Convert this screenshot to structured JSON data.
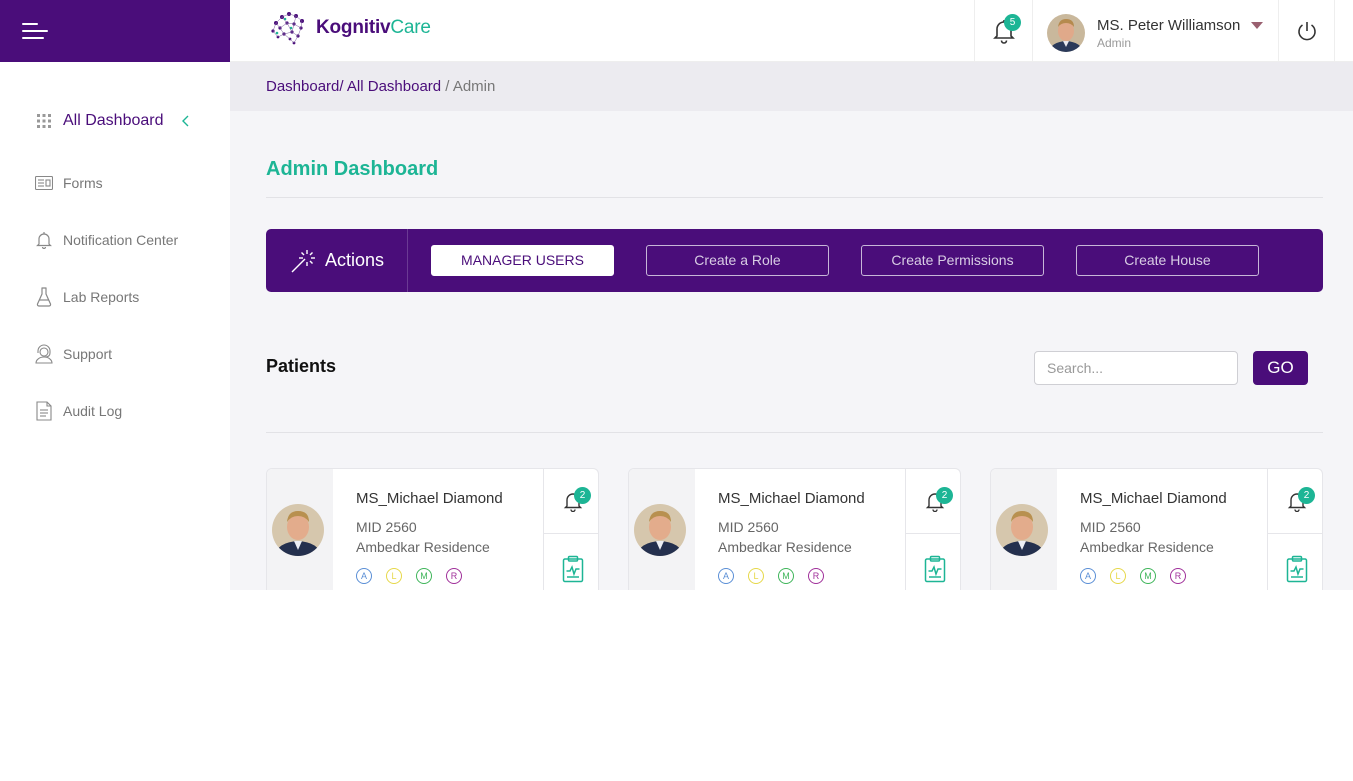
{
  "app": {
    "logo_main": "Kognitiv",
    "logo_accent": "Care"
  },
  "sidebar": {
    "items": [
      {
        "label": "All Dashboard",
        "icon": "grid-icon"
      },
      {
        "label": "Forms",
        "icon": "form-icon"
      },
      {
        "label": "Notification Center",
        "icon": "bell-icon"
      },
      {
        "label": "Lab Reports",
        "icon": "flask-icon"
      },
      {
        "label": "Support",
        "icon": "support-agent-icon"
      },
      {
        "label": "Audit Log",
        "icon": "document-icon"
      }
    ]
  },
  "header": {
    "notification_count": "5",
    "user_name": "MS. Peter Williamson",
    "user_role": "Admin"
  },
  "breadcrumb": {
    "part1": "Dashboard/",
    "part2": "All Dashboard",
    "separator": "/",
    "current": "Admin"
  },
  "page": {
    "title": "Admin Dashboard"
  },
  "actions": {
    "label": "Actions",
    "buttons": [
      "MANAGER USERS",
      "Create a Role",
      "Create Permissions",
      "Create House"
    ]
  },
  "patients": {
    "title": "Patients",
    "search_placeholder": "Search...",
    "go_label": "GO",
    "cards": [
      {
        "name": "MS_Michael Diamond",
        "mid": "MID 2560",
        "residence": "Ambedkar Residence",
        "alerts": "2",
        "tags": [
          "A",
          "L",
          "M",
          "R"
        ]
      },
      {
        "name": "MS_Michael Diamond",
        "mid": "MID 2560",
        "residence": "Ambedkar Residence",
        "alerts": "2",
        "tags": [
          "A",
          "L",
          "M",
          "R"
        ]
      },
      {
        "name": "MS_Michael Diamond",
        "mid": "MID 2560",
        "residence": "Ambedkar Residence",
        "alerts": "2",
        "tags": [
          "A",
          "L",
          "M",
          "R"
        ]
      }
    ]
  },
  "colors": {
    "brand_purple": "#4a0d7a",
    "accent_green": "#1db595",
    "tag_a": "#5b8fd6",
    "tag_l": "#e6d84a",
    "tag_m": "#3fb55a",
    "tag_r": "#a0309a"
  }
}
